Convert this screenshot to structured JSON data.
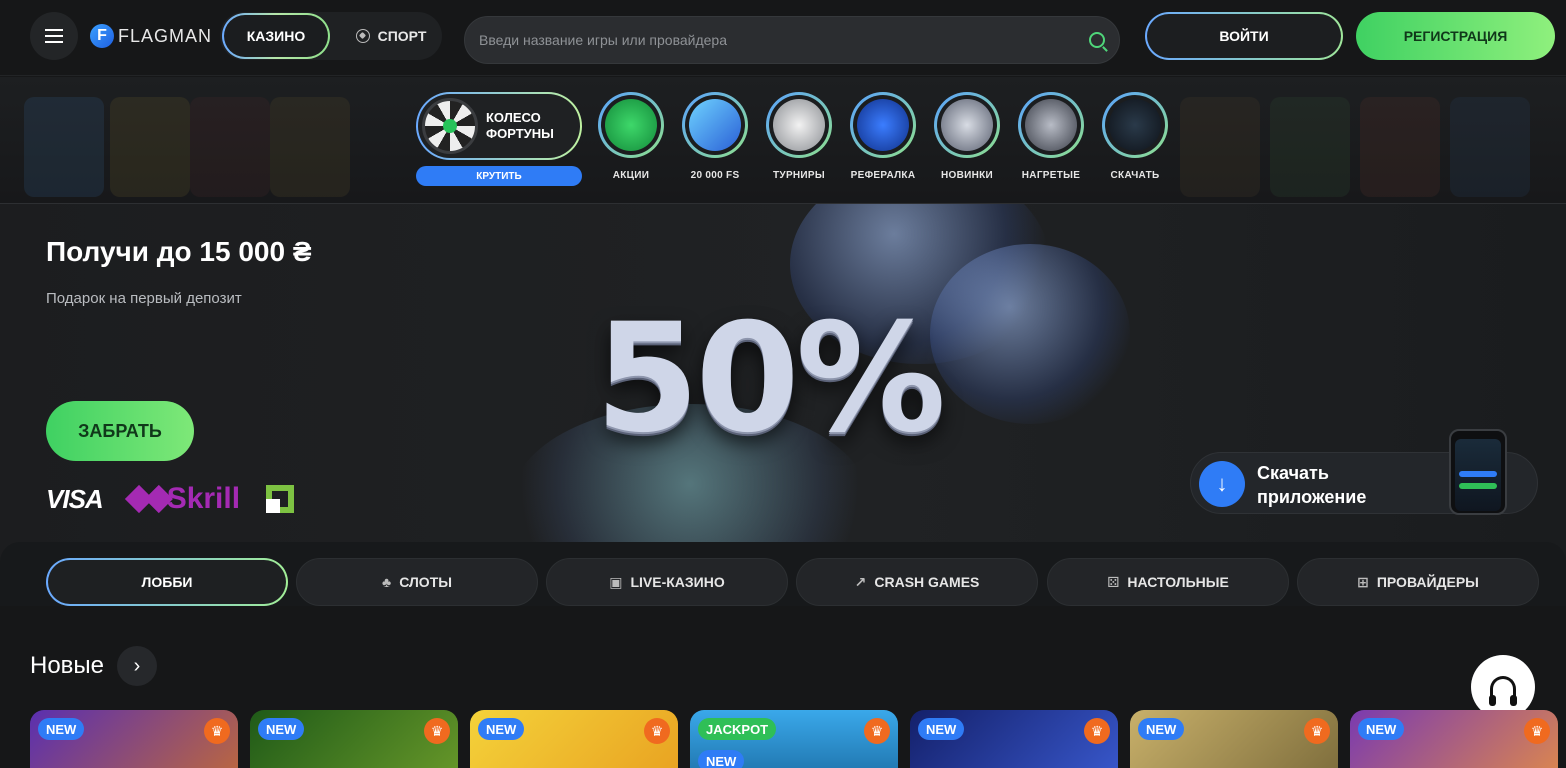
{
  "header": {
    "logo_text": "FLAGMAN",
    "logo_letter": "F",
    "mode_casino": "КАЗИНО",
    "mode_sport": "СПОРТ",
    "search_placeholder": "Введи название игры или провайдера",
    "login_label": "ВОЙТИ",
    "register_label": "РЕГИСТРАЦИЯ"
  },
  "quick": {
    "fortune_label": "КОЛЕСО ФОРТУНЫ",
    "spin_label": "КРУТИТЬ",
    "items": [
      {
        "label": "АКЦИИ",
        "icon": "gift-bomb-icon"
      },
      {
        "label": "20 000 FS",
        "icon": "ticket-icon"
      },
      {
        "label": "ТУРНИРЫ",
        "icon": "trophy-cup-icon"
      },
      {
        "label": "РЕФЕРАЛКА",
        "icon": "money-bag-icon"
      },
      {
        "label": "НОВИНКИ",
        "icon": "gamepad-icon"
      },
      {
        "label": "НАГРЕТЫЕ",
        "icon": "rocket-icon"
      },
      {
        "label": "СКАЧАТЬ",
        "icon": "phone-icon"
      }
    ]
  },
  "banner": {
    "title": "Получи до 15 000 ₴",
    "subtitle": "Подарок на первый депозит",
    "percent": "50%",
    "claim_label": "ЗАБРАТЬ",
    "payments": {
      "visa": "VISA",
      "skrill": "Skrill"
    },
    "download_label": "Скачать приложение"
  },
  "tabs": [
    {
      "label": "ЛОББИ",
      "icon": ""
    },
    {
      "label": "СЛОТЫ",
      "icon": "cherry-icon"
    },
    {
      "label": "LIVE-КАЗИНО",
      "icon": "live-icon"
    },
    {
      "label": "CRASH GAMES",
      "icon": "chart-up-icon"
    },
    {
      "label": "НАСТОЛЬНЫЕ",
      "icon": "dice-icon"
    },
    {
      "label": "ПРОВАЙДЕРЫ",
      "icon": "grid-icon"
    }
  ],
  "section": {
    "title": "Новые",
    "arrow": "›"
  },
  "games": [
    {
      "badge": "NEW",
      "badge2": "",
      "bg": "#6b3fb8"
    },
    {
      "badge": "NEW",
      "badge2": "",
      "bg": "#2e6b1e"
    },
    {
      "badge": "NEW",
      "badge2": "",
      "bg": "#f0c020"
    },
    {
      "badge": "JACKPOT",
      "badge2": "NEW",
      "bg": "#2a8ad6"
    },
    {
      "badge": "NEW",
      "badge2": "",
      "bg": "#1a2a7a"
    },
    {
      "badge": "NEW",
      "badge2": "",
      "bg": "#b8a05a"
    },
    {
      "badge": "NEW",
      "badge2": "",
      "bg": "#8a4ab0"
    }
  ],
  "colors": {
    "accent_green": "#3fd162",
    "accent_blue": "#2f7cf6",
    "background": "#161718"
  }
}
